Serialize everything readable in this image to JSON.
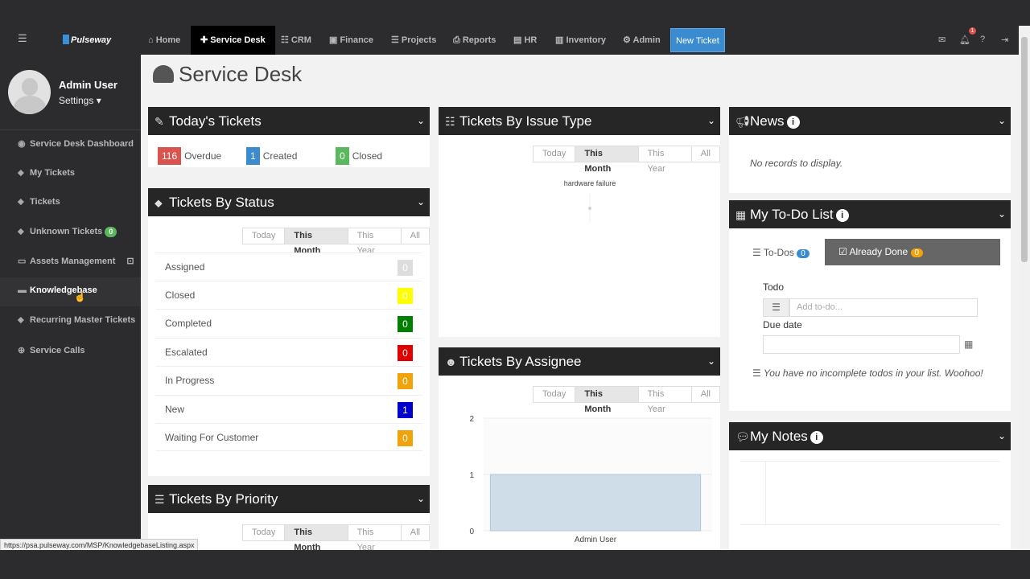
{
  "nav": {
    "logo": "Pulseway",
    "items": [
      {
        "icon": "home-icon",
        "label": "Home"
      },
      {
        "icon": "wrench-icon",
        "label": "Service Desk"
      },
      {
        "icon": "users-icon",
        "label": "CRM"
      },
      {
        "icon": "money-icon",
        "label": "Finance"
      },
      {
        "icon": "list-icon",
        "label": "Projects"
      },
      {
        "icon": "print-icon",
        "label": "Reports"
      },
      {
        "icon": "id-card-icon",
        "label": "HR"
      },
      {
        "icon": "box-icon",
        "label": "Inventory"
      },
      {
        "icon": "gear-icon",
        "label": "Admin"
      }
    ],
    "new_ticket": "New Ticket",
    "notification_count": "1"
  },
  "sidebar": {
    "user_name": "Admin User",
    "settings_label": "Settings",
    "items": [
      {
        "icon": "dashboard-icon",
        "label": "Service Desk Dashboard"
      },
      {
        "icon": "tag-icon",
        "label": "My Tickets"
      },
      {
        "icon": "tag-icon",
        "label": "Tickets"
      },
      {
        "icon": "question-icon",
        "label": "Unknown Tickets",
        "count": "0"
      },
      {
        "icon": "laptop-icon",
        "label": "Assets Management"
      },
      {
        "icon": "book-icon",
        "label": "Knowledgebase"
      },
      {
        "icon": "tag-icon",
        "label": "Recurring Master Tickets"
      },
      {
        "icon": "globe-icon",
        "label": "Service Calls"
      }
    ]
  },
  "page": {
    "title": "Service Desk"
  },
  "filters": {
    "today": "Today",
    "month": "This Month",
    "year": "This Year",
    "all": "All"
  },
  "todays_tickets": {
    "title": "Today's Tickets",
    "overdue_count": "116",
    "overdue_label": "Overdue",
    "created_count": "1",
    "created_label": "Created",
    "closed_count": "0",
    "closed_label": "Closed"
  },
  "tickets_by_status": {
    "title": "Tickets By Status",
    "rows": [
      {
        "label": "Assigned",
        "value": "0",
        "color": "#dddddd"
      },
      {
        "label": "Closed",
        "value": "0",
        "color": "#ffff00"
      },
      {
        "label": "Completed",
        "value": "0",
        "color": "#008000"
      },
      {
        "label": "Escalated",
        "value": "0",
        "color": "#e00000"
      },
      {
        "label": "In Progress",
        "value": "0",
        "color": "#f0a30a"
      },
      {
        "label": "New",
        "value": "1",
        "color": "#0000cc"
      },
      {
        "label": "Waiting For Customer",
        "value": "0",
        "color": "#f0a30a"
      }
    ]
  },
  "tickets_by_priority": {
    "title": "Tickets By Priority"
  },
  "tickets_by_issue_type": {
    "title": "Tickets By Issue Type",
    "chart_label": "hardware failure"
  },
  "tickets_by_assignee": {
    "title": "Tickets By Assignee"
  },
  "news": {
    "title": "News",
    "empty": "No records to display."
  },
  "todo": {
    "title": "My To-Do List",
    "tab_todos": "To-Dos",
    "todos_count": "0",
    "tab_done": "Already Done",
    "done_count": "0",
    "todo_label": "Todo",
    "todo_placeholder": "Add to-do...",
    "due_label": "Due date",
    "empty": "You have no incomplete todos in your list. Woohoo!"
  },
  "notes": {
    "title": "My Notes"
  },
  "status_url": "https://psa.pulseway.com/MSP/KnowledgebaseListing.aspx",
  "chart_data": [
    {
      "type": "pie",
      "categories": [
        "hardware failure"
      ],
      "values": [
        1
      ]
    },
    {
      "type": "bar",
      "categories": [
        "Admin User"
      ],
      "values": [
        1
      ],
      "ylim": [
        0,
        2
      ],
      "yticks": [
        0,
        1,
        2
      ]
    }
  ]
}
